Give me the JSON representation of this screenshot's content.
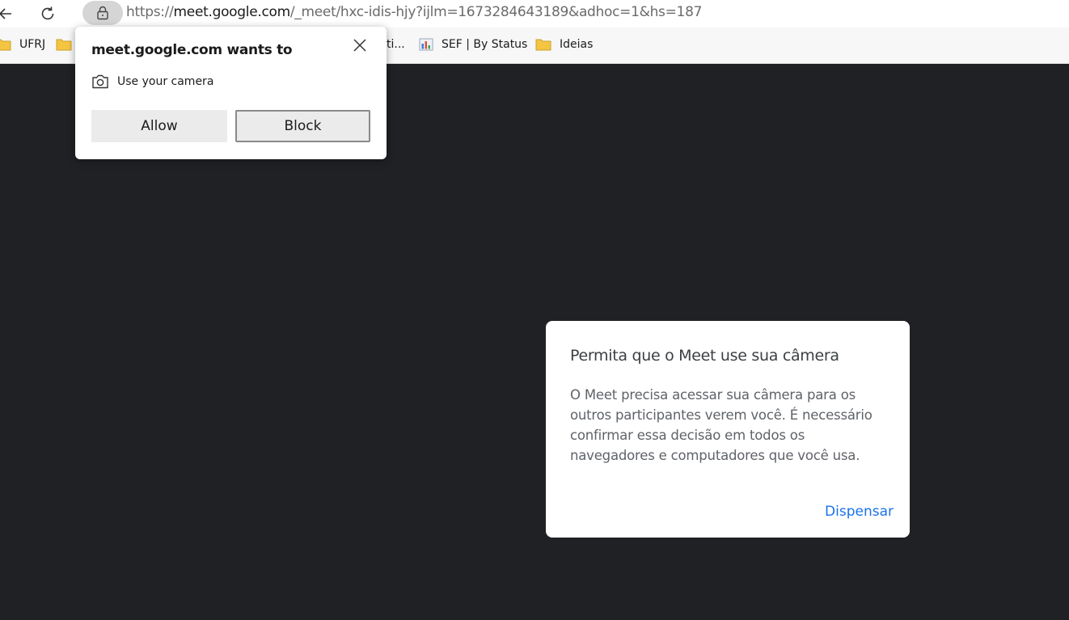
{
  "browser": {
    "url_scheme": "https://",
    "url_host": "meet.google.com",
    "url_path": "/_meet/hxc-idis-hjy?ijlm=1673284643189&adhoc=1&hs=187"
  },
  "bookmarks": [
    {
      "label": "UFRJ",
      "icon": "folder-icon"
    },
    {
      "label": "",
      "icon": "folder-icon"
    },
    {
      "label": "ti...",
      "icon": ""
    },
    {
      "label": "SEF | By Status",
      "icon": "chart-icon"
    },
    {
      "label": "Ideias",
      "icon": "folder-icon"
    }
  ],
  "permission_prompt": {
    "title": "meet.google.com wants to",
    "permission_label": "Use your camera",
    "allow_label": "Allow",
    "block_label": "Block"
  },
  "meet_dialog": {
    "title": "Permita que o Meet use sua câmera",
    "body_lines": [
      "O Meet precisa acessar sua câmera para os",
      "outros participantes verem você. É necessário",
      "confirmar essa decisão em todos os",
      "navegadores e computadores que você usa."
    ],
    "dismiss_label": "Dispensar"
  },
  "colors": {
    "page_background": "#202124",
    "link_blue": "#1a73e8",
    "folder_yellow": "#f5c542"
  }
}
